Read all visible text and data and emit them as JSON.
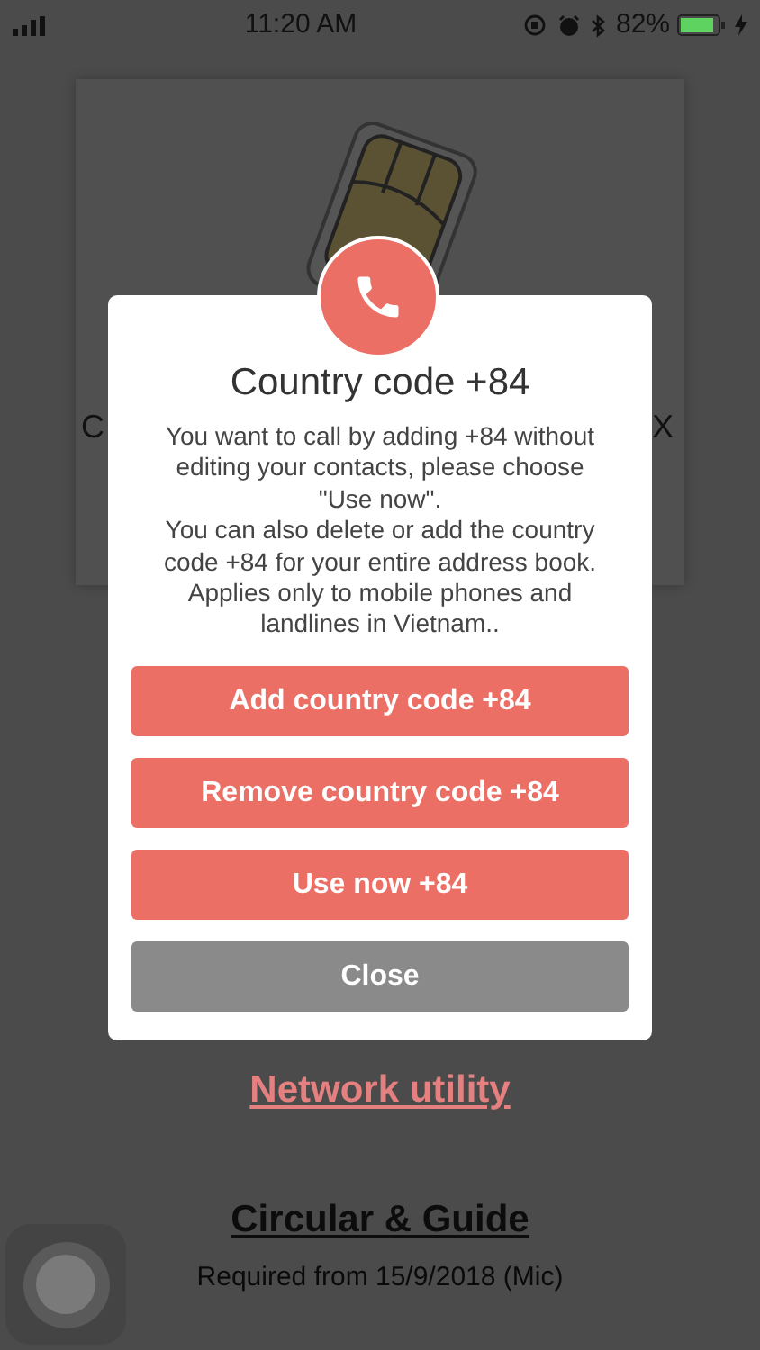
{
  "status_bar": {
    "time": "11:20 AM",
    "battery": "82%"
  },
  "card": {
    "text_start": "C",
    "text_end": "X"
  },
  "dialog": {
    "title": "Country code +84",
    "message": "You want to call by adding +84 without editing your contacts, please choose \"Use now\".\nYou can also delete or add the country code +84 for your entire address book. Applies only to mobile phones and landlines in Vietnam..",
    "buttons": [
      {
        "label": "Add country code +84",
        "kind": "primary"
      },
      {
        "label": "Remove country code +84",
        "kind": "primary"
      },
      {
        "label": "Use now +84",
        "kind": "primary"
      },
      {
        "label": "Close",
        "kind": "secondary"
      }
    ]
  },
  "links": [
    {
      "label": "Network utility",
      "kind": "accent"
    },
    {
      "label": "Circular & Guide",
      "kind": "plain"
    }
  ],
  "note": "Required from 15/9/2018 (Mic)"
}
